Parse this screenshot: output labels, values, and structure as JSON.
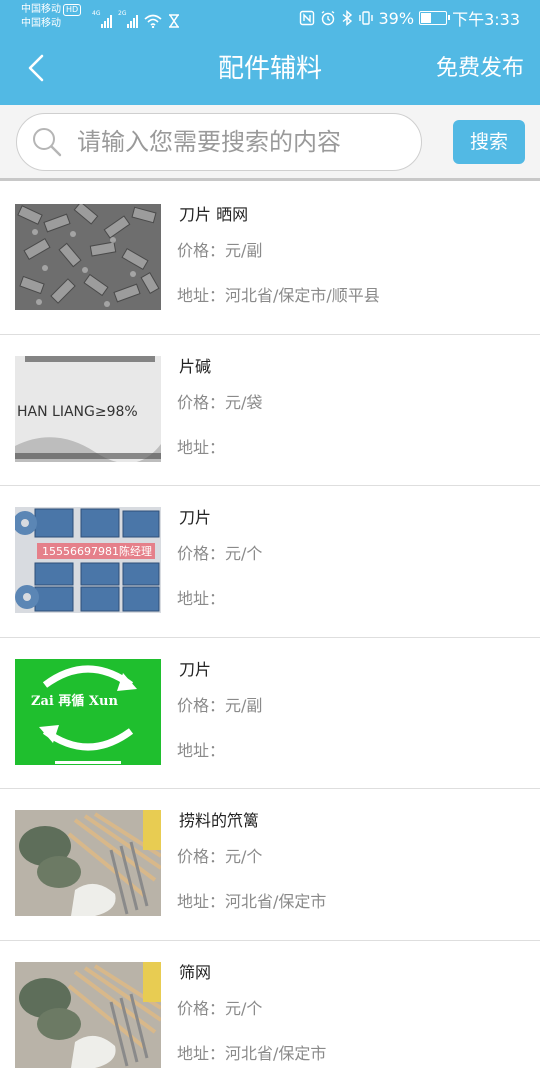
{
  "status_bar": {
    "carrier_1": "中国移动",
    "hd_badge": "HD",
    "carrier_2": "中国移动",
    "signal_1_tag": "4G",
    "signal_2_tag": "2G",
    "battery_percent": "39%",
    "battery_level": 0.39,
    "time": "下午3:33",
    "icons": [
      "nfc-icon",
      "alarm-icon",
      "bluetooth-icon",
      "vibrate-icon",
      "battery-icon"
    ]
  },
  "header": {
    "title": "配件辅料",
    "publish_label": "免费发布",
    "color": "#52b9e4"
  },
  "search": {
    "placeholder": "请输入您需要搜索的内容",
    "button_label": "搜索"
  },
  "items": [
    {
      "title": "刀片 晒网",
      "price": "价格：元/副",
      "address": "地址：河北省/保定市/顺平县"
    },
    {
      "title": "片碱",
      "price": "价格：元/袋",
      "address": "地址：",
      "image_text": "HAN LIANG≥98%"
    },
    {
      "title": "刀片",
      "price": "价格：元/个",
      "address": "地址：",
      "image_text": "15556697981陈经理"
    },
    {
      "title": "刀片",
      "price": "价格：元/副",
      "address": "地址：",
      "image_text": "Zai 再循 Xun"
    },
    {
      "title": "捞料的笊篱",
      "price": "价格：元/个",
      "address": "地址：河北省/保定市"
    },
    {
      "title": "筛网",
      "price": "价格：元/个",
      "address": "地址：河北省/保定市"
    }
  ]
}
